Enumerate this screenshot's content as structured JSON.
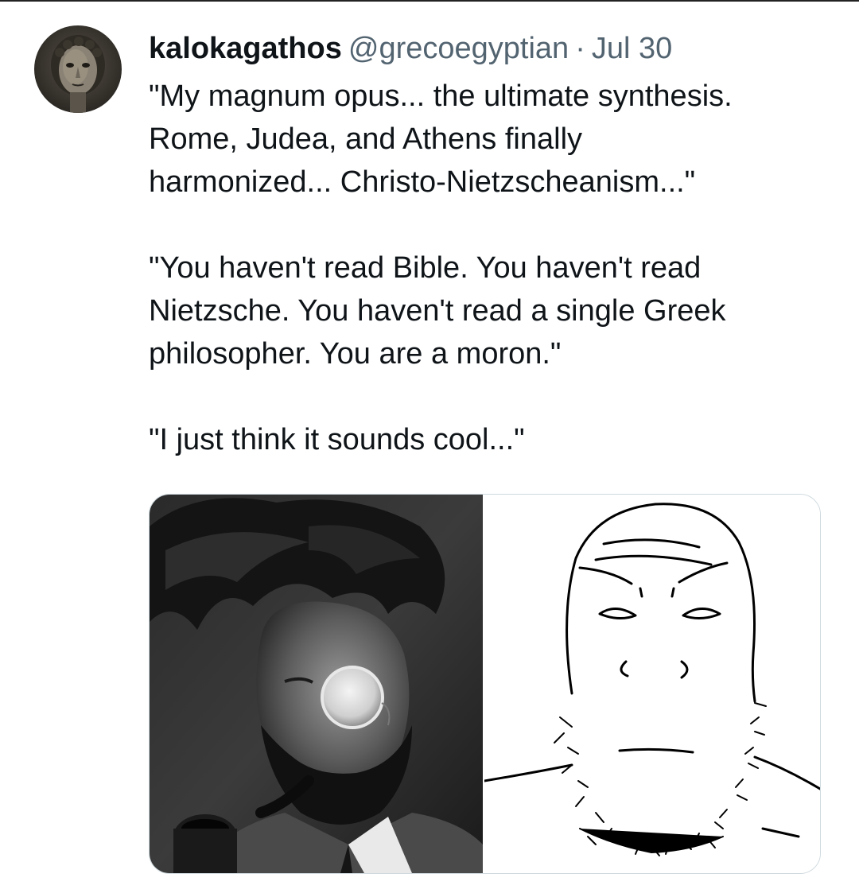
{
  "tweet": {
    "display_name": "kalokagathos",
    "handle": "@grecoegyptian",
    "separator": "·",
    "date": "Jul 30",
    "paragraphs": [
      "\"My magnum opus... the ultimate synthesis.\nRome, Judea, and Athens finally\nharmonized... Christo-Nietzscheanism...\"",
      "\"You haven't read Bible. You haven't read\nNietzsche. You haven't read a single Greek\nphilosopher. You are a moron.\"",
      "\"I just think it sounds cool...\""
    ]
  },
  "media": {
    "count": 2,
    "images": [
      {
        "depicts": "black-and-white photo of bearded man with monocle and pipe"
      },
      {
        "depicts": "wojak-style line drawing of bald bearded man"
      }
    ]
  },
  "colors": {
    "text_primary": "#0f1419",
    "text_secondary": "#536471",
    "card_border": "#cfd9de",
    "background": "#ffffff"
  }
}
